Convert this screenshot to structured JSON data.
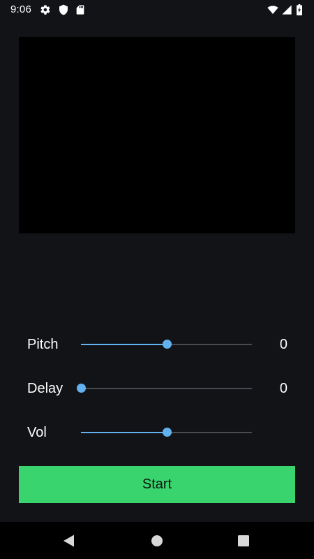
{
  "status_bar": {
    "time": "9:06",
    "icons": [
      "settings-gear-icon",
      "shield-icon",
      "sd-card-icon",
      "wifi-icon",
      "cell-signal-icon",
      "battery-charging-icon"
    ]
  },
  "controls": [
    {
      "label": "Pitch",
      "value": "0",
      "slider_fraction": 0.5
    },
    {
      "label": "Delay",
      "value": "0",
      "slider_fraction": 0.0
    },
    {
      "label": "Vol",
      "value": "",
      "slider_fraction": 0.5
    }
  ],
  "start_button": {
    "label": "Start"
  },
  "nav_bar": {
    "icons": [
      "back-icon",
      "home-icon",
      "recents-icon"
    ]
  },
  "colors": {
    "background": "#121317",
    "accent_slider": "#62b2f0",
    "start_button": "#3ad46e",
    "preview": "#000000",
    "nav_bar": "#000000"
  }
}
